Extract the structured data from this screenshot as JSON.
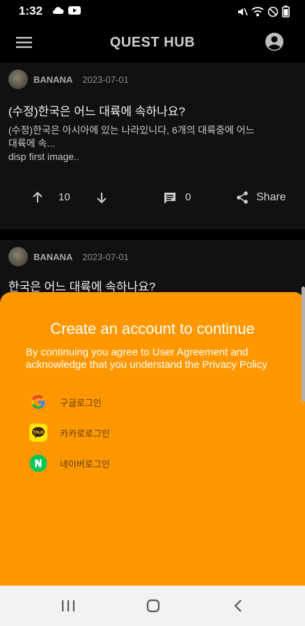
{
  "status_bar": {
    "time": "1:32"
  },
  "app_bar": {
    "title": "QUEST HUB"
  },
  "posts": [
    {
      "author": "BANANA",
      "date": "2023-07-01",
      "title": "(수정)한국은 어느 대륙에 속하나요?",
      "body_line1": "(수정)한국은 아시아에 있는 나라있니다, 6개의 대륙중에 어느",
      "body_line2": "대륙에 속...",
      "body_line3": "disp first image..",
      "votes": "10",
      "comments": "0",
      "share_label": "Share"
    },
    {
      "author": "BANANA",
      "date": "2023-07-01",
      "title": "한국은 어느 대륙에 속하나요?"
    }
  ],
  "sheet": {
    "title": "Create an account to continue",
    "description": "By continuing you agree to User Agreement and acknowledge that you understand the Privacy Policy",
    "google_label": "구글로그인",
    "kakao_label": "카카로로그인",
    "naver_label": "네이버로그인",
    "accent_color": "#ff9800"
  },
  "icons": [
    "menu-icon",
    "account-icon",
    "arrow-up-icon",
    "arrow-down-icon",
    "comment-icon",
    "share-icon",
    "google-icon",
    "kakao-icon",
    "naver-icon",
    "recents-icon",
    "home-icon",
    "back-icon"
  ]
}
